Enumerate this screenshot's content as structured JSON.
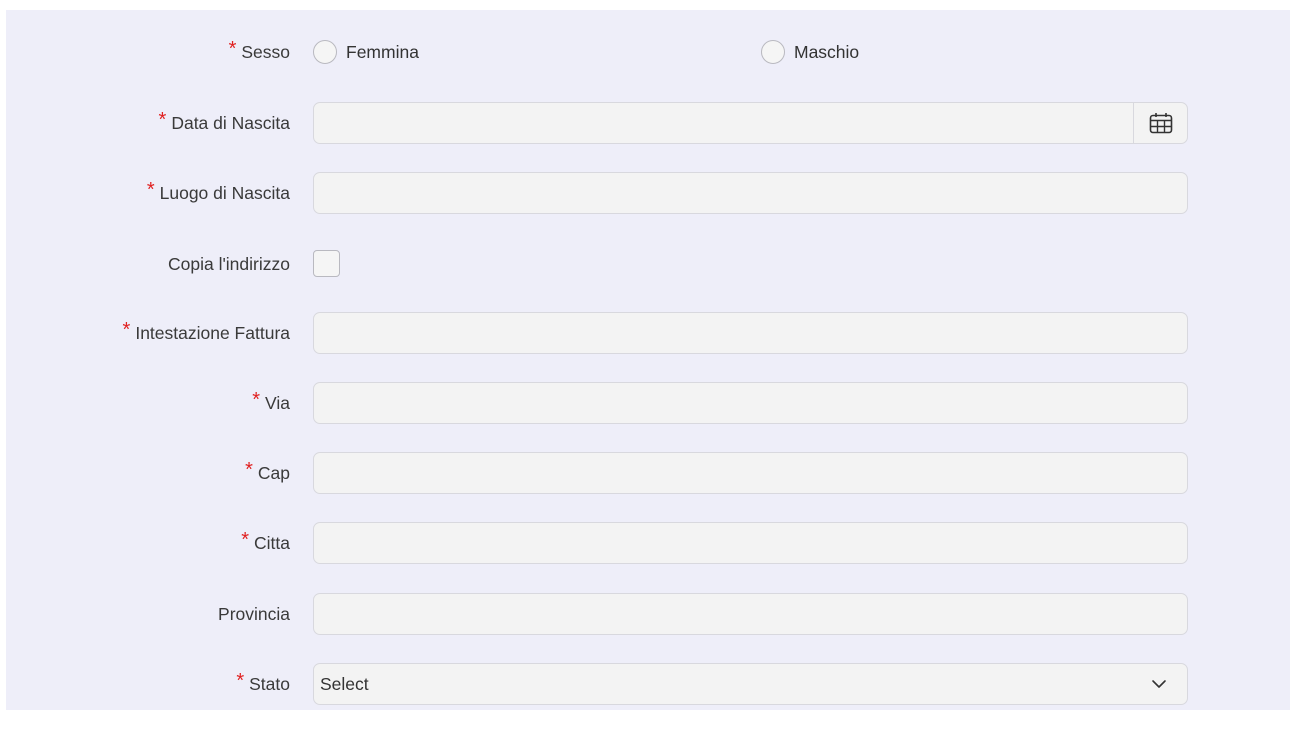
{
  "form": {
    "required_marker": "*",
    "sesso": {
      "label": "Sesso",
      "options": [
        "Femmina",
        "Maschio"
      ]
    },
    "data_nascita": {
      "label": "Data di Nascita",
      "value": "",
      "icon": "calendar-icon"
    },
    "luogo_nascita": {
      "label": "Luogo di Nascita",
      "value": ""
    },
    "copia_indirizzo": {
      "label": "Copia l'indirizzo",
      "checked": false
    },
    "intestazione_fattura": {
      "label": "Intestazione Fattura",
      "value": ""
    },
    "via": {
      "label": "Via",
      "value": ""
    },
    "cap": {
      "label": "Cap",
      "value": ""
    },
    "citta": {
      "label": "Citta",
      "value": ""
    },
    "provincia": {
      "label": "Provincia",
      "value": ""
    },
    "stato": {
      "label": "Stato",
      "selected": "Select",
      "icon": "chevron-down-icon"
    }
  },
  "colors": {
    "panel_bg": "#eeeef9",
    "required": "#e02020",
    "input_bg": "#f3f3f3",
    "input_border": "#d8d8de"
  }
}
